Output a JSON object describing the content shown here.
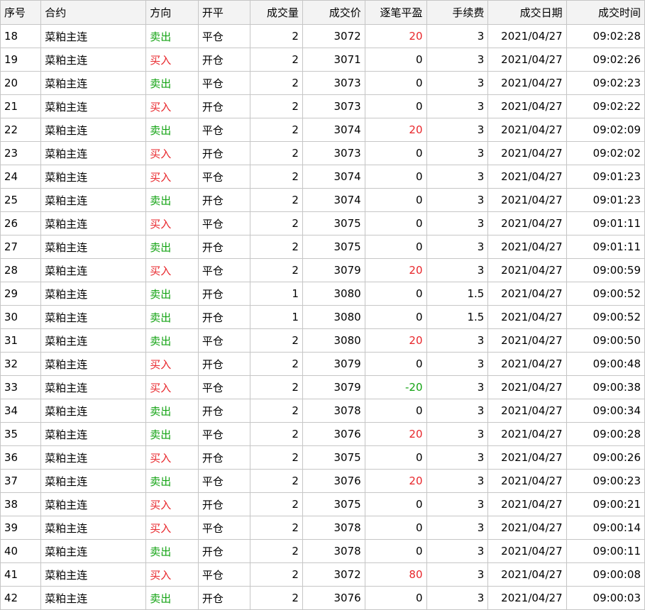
{
  "columns": [
    "序号",
    "合约",
    "方向",
    "开平",
    "成交量",
    "成交价",
    "逐笔平盈",
    "手续费",
    "成交日期",
    "成交时间"
  ],
  "rows": [
    {
      "seq": "18",
      "contract": "菜粕主连",
      "direction": "卖出",
      "openclose": "平仓",
      "volume": "2",
      "price": "3072",
      "pnl": "20",
      "fee": "3",
      "date": "2021/04/27",
      "time": "09:02:28"
    },
    {
      "seq": "19",
      "contract": "菜粕主连",
      "direction": "买入",
      "openclose": "开仓",
      "volume": "2",
      "price": "3071",
      "pnl": "0",
      "fee": "3",
      "date": "2021/04/27",
      "time": "09:02:26"
    },
    {
      "seq": "20",
      "contract": "菜粕主连",
      "direction": "卖出",
      "openclose": "平仓",
      "volume": "2",
      "price": "3073",
      "pnl": "0",
      "fee": "3",
      "date": "2021/04/27",
      "time": "09:02:23"
    },
    {
      "seq": "21",
      "contract": "菜粕主连",
      "direction": "买入",
      "openclose": "开仓",
      "volume": "2",
      "price": "3073",
      "pnl": "0",
      "fee": "3",
      "date": "2021/04/27",
      "time": "09:02:22"
    },
    {
      "seq": "22",
      "contract": "菜粕主连",
      "direction": "卖出",
      "openclose": "平仓",
      "volume": "2",
      "price": "3074",
      "pnl": "20",
      "fee": "3",
      "date": "2021/04/27",
      "time": "09:02:09"
    },
    {
      "seq": "23",
      "contract": "菜粕主连",
      "direction": "买入",
      "openclose": "开仓",
      "volume": "2",
      "price": "3073",
      "pnl": "0",
      "fee": "3",
      "date": "2021/04/27",
      "time": "09:02:02"
    },
    {
      "seq": "24",
      "contract": "菜粕主连",
      "direction": "买入",
      "openclose": "平仓",
      "volume": "2",
      "price": "3074",
      "pnl": "0",
      "fee": "3",
      "date": "2021/04/27",
      "time": "09:01:23"
    },
    {
      "seq": "25",
      "contract": "菜粕主连",
      "direction": "卖出",
      "openclose": "开仓",
      "volume": "2",
      "price": "3074",
      "pnl": "0",
      "fee": "3",
      "date": "2021/04/27",
      "time": "09:01:23"
    },
    {
      "seq": "26",
      "contract": "菜粕主连",
      "direction": "买入",
      "openclose": "平仓",
      "volume": "2",
      "price": "3075",
      "pnl": "0",
      "fee": "3",
      "date": "2021/04/27",
      "time": "09:01:11"
    },
    {
      "seq": "27",
      "contract": "菜粕主连",
      "direction": "卖出",
      "openclose": "开仓",
      "volume": "2",
      "price": "3075",
      "pnl": "0",
      "fee": "3",
      "date": "2021/04/27",
      "time": "09:01:11"
    },
    {
      "seq": "28",
      "contract": "菜粕主连",
      "direction": "买入",
      "openclose": "平仓",
      "volume": "2",
      "price": "3079",
      "pnl": "20",
      "fee": "3",
      "date": "2021/04/27",
      "time": "09:00:59"
    },
    {
      "seq": "29",
      "contract": "菜粕主连",
      "direction": "卖出",
      "openclose": "开仓",
      "volume": "1",
      "price": "3080",
      "pnl": "0",
      "fee": "1.5",
      "date": "2021/04/27",
      "time": "09:00:52"
    },
    {
      "seq": "30",
      "contract": "菜粕主连",
      "direction": "卖出",
      "openclose": "开仓",
      "volume": "1",
      "price": "3080",
      "pnl": "0",
      "fee": "1.5",
      "date": "2021/04/27",
      "time": "09:00:52"
    },
    {
      "seq": "31",
      "contract": "菜粕主连",
      "direction": "卖出",
      "openclose": "平仓",
      "volume": "2",
      "price": "3080",
      "pnl": "20",
      "fee": "3",
      "date": "2021/04/27",
      "time": "09:00:50"
    },
    {
      "seq": "32",
      "contract": "菜粕主连",
      "direction": "买入",
      "openclose": "开仓",
      "volume": "2",
      "price": "3079",
      "pnl": "0",
      "fee": "3",
      "date": "2021/04/27",
      "time": "09:00:48"
    },
    {
      "seq": "33",
      "contract": "菜粕主连",
      "direction": "买入",
      "openclose": "平仓",
      "volume": "2",
      "price": "3079",
      "pnl": "-20",
      "fee": "3",
      "date": "2021/04/27",
      "time": "09:00:38"
    },
    {
      "seq": "34",
      "contract": "菜粕主连",
      "direction": "卖出",
      "openclose": "开仓",
      "volume": "2",
      "price": "3078",
      "pnl": "0",
      "fee": "3",
      "date": "2021/04/27",
      "time": "09:00:34"
    },
    {
      "seq": "35",
      "contract": "菜粕主连",
      "direction": "卖出",
      "openclose": "平仓",
      "volume": "2",
      "price": "3076",
      "pnl": "20",
      "fee": "3",
      "date": "2021/04/27",
      "time": "09:00:28"
    },
    {
      "seq": "36",
      "contract": "菜粕主连",
      "direction": "买入",
      "openclose": "开仓",
      "volume": "2",
      "price": "3075",
      "pnl": "0",
      "fee": "3",
      "date": "2021/04/27",
      "time": "09:00:26"
    },
    {
      "seq": "37",
      "contract": "菜粕主连",
      "direction": "卖出",
      "openclose": "平仓",
      "volume": "2",
      "price": "3076",
      "pnl": "20",
      "fee": "3",
      "date": "2021/04/27",
      "time": "09:00:23"
    },
    {
      "seq": "38",
      "contract": "菜粕主连",
      "direction": "买入",
      "openclose": "开仓",
      "volume": "2",
      "price": "3075",
      "pnl": "0",
      "fee": "3",
      "date": "2021/04/27",
      "time": "09:00:21"
    },
    {
      "seq": "39",
      "contract": "菜粕主连",
      "direction": "买入",
      "openclose": "平仓",
      "volume": "2",
      "price": "3078",
      "pnl": "0",
      "fee": "3",
      "date": "2021/04/27",
      "time": "09:00:14"
    },
    {
      "seq": "40",
      "contract": "菜粕主连",
      "direction": "卖出",
      "openclose": "开仓",
      "volume": "2",
      "price": "3078",
      "pnl": "0",
      "fee": "3",
      "date": "2021/04/27",
      "time": "09:00:11"
    },
    {
      "seq": "41",
      "contract": "菜粕主连",
      "direction": "买入",
      "openclose": "平仓",
      "volume": "2",
      "price": "3072",
      "pnl": "80",
      "fee": "3",
      "date": "2021/04/27",
      "time": "09:00:08"
    },
    {
      "seq": "42",
      "contract": "菜粕主连",
      "direction": "卖出",
      "openclose": "开仓",
      "volume": "2",
      "price": "3076",
      "pnl": "0",
      "fee": "3",
      "date": "2021/04/27",
      "time": "09:00:03"
    }
  ],
  "colors": {
    "buy": "#e8262b",
    "sell": "#13a313",
    "profit": "#e8262b",
    "loss": "#13a313",
    "grid": "#c6c6c6",
    "header_bg": "#f3f3f3"
  }
}
